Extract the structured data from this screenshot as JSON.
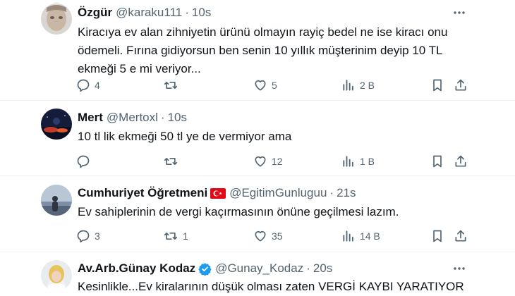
{
  "tweets": [
    {
      "name": "Özgür",
      "handle": "@karaku111",
      "sep": "·",
      "time": "10s",
      "text": "Kiracıya ev alan zihniyetin ürünü olmayın rayiç bedel ne ise kiracı onu ödemeli. Fırına gidiyorsun ben senin 10 yıllık müşterinim deyip 10 TL ekmeği 5 e mi veriyor...",
      "replies": "4",
      "retweets": "",
      "likes": "5",
      "views": "2 B"
    },
    {
      "name": "Mert",
      "handle": "@Mertoxl",
      "sep": "·",
      "time": "10s",
      "text": "10 tl lik ekmeği 50 tl ye de vermiyor ama",
      "replies": "",
      "retweets": "",
      "likes": "12",
      "views": "1 B"
    },
    {
      "name": "Cumhuriyet Öğretmeni",
      "handle": "@EgitimGunluguu",
      "sep": "·",
      "time": "21s",
      "text": "Ev sahiplerinin de vergi kaçırmasının önüne geçilmesi lazım.",
      "replies": "3",
      "retweets": "1",
      "likes": "35",
      "views": "14 B"
    },
    {
      "name": "Av.Arb.Günay Kodaz",
      "handle": "@Gunay_Kodaz",
      "sep": "·",
      "time": "20s",
      "text": "Kesinlikle...Ev kiralarının düşük olması zaten VERGİ KAYBI YARATIYOR"
    }
  ],
  "icons": {
    "more": "more-dots-icon",
    "reply": "reply-icon",
    "retweet": "retweet-icon",
    "like": "heart-icon",
    "views": "views-icon",
    "bookmark": "bookmark-icon",
    "share": "share-icon",
    "flag": "turkey-flag-icon",
    "verified": "verified-badge-icon"
  },
  "colors": {
    "text": "#0f1419",
    "secondary": "#536471",
    "divider": "#eff3f4",
    "verified": "#1d9bf0",
    "flag": "#e30a17"
  }
}
